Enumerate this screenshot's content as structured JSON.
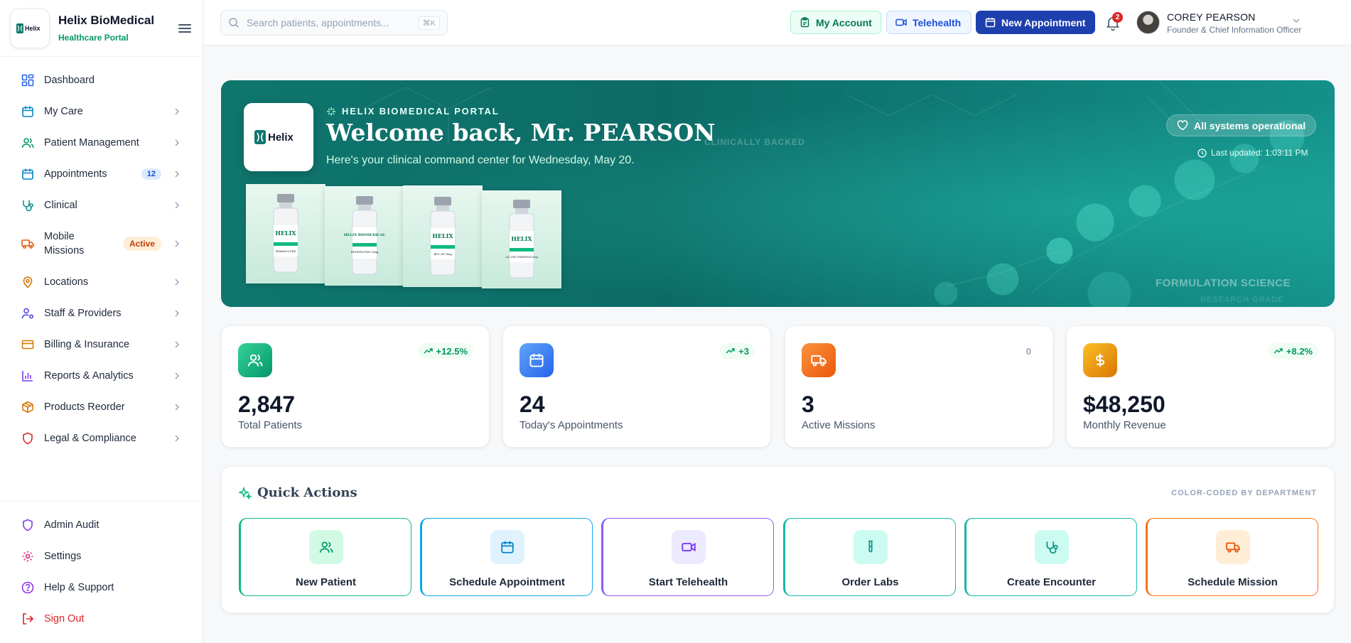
{
  "brand": {
    "name": "Helix BioMedical",
    "subtitle": "Healthcare Portal",
    "logo_text": "Helix"
  },
  "sidebar": {
    "items": [
      {
        "label": "Dashboard",
        "icon": "grid-icon",
        "color": "#2563eb"
      },
      {
        "label": "My Care",
        "icon": "calendar-icon",
        "color": "#0284c7"
      },
      {
        "label": "Patient Management",
        "icon": "users-icon",
        "color": "#059669"
      },
      {
        "label": "Appointments",
        "icon": "calendar-icon",
        "color": "#0284c7",
        "badge": "12"
      },
      {
        "label": "Clinical",
        "icon": "stethoscope-icon",
        "color": "#0d9488"
      },
      {
        "label": "Mobile Missions",
        "icon": "truck-icon",
        "color": "#ea580c",
        "badge": "Active"
      },
      {
        "label": "Locations",
        "icon": "map-pin-icon",
        "color": "#d97706"
      },
      {
        "label": "Staff & Providers",
        "icon": "user-cog-icon",
        "color": "#4f46e5"
      },
      {
        "label": "Billing & Insurance",
        "icon": "credit-card-icon",
        "color": "#d97706"
      },
      {
        "label": "Reports & Analytics",
        "icon": "bar-chart-icon",
        "color": "#7c3aed"
      },
      {
        "label": "Products Reorder",
        "icon": "package-icon",
        "color": "#d97706"
      },
      {
        "label": "Legal & Compliance",
        "icon": "shield-icon",
        "color": "#dc2626"
      }
    ],
    "bottom": [
      {
        "label": "Admin Audit",
        "icon": "shield-icon",
        "color": "#7c3aed"
      },
      {
        "label": "Settings",
        "icon": "gear-icon",
        "color": "#db2777"
      },
      {
        "label": "Help & Support",
        "icon": "help-circle-icon",
        "color": "#9333ea"
      },
      {
        "label": "Sign Out",
        "icon": "logout-icon",
        "color": "#dc2626"
      }
    ]
  },
  "topbar": {
    "search_placeholder": "Search patients, appointments...",
    "search_shortcut": "⌘K",
    "my_account": "My Account",
    "telehealth": "Telehealth",
    "new_appointment": "New Appointment",
    "notification_count": "2",
    "user_name": "COREY PEARSON",
    "user_role": "Founder & Chief Information Officer"
  },
  "hero": {
    "eyebrow": "HELIX BIOMEDICAL PORTAL",
    "title": "Welcome back, Mr. PEARSON",
    "subtitle": "Here's your clinical command center for Wednesday, May 20.",
    "status": "All systems operational",
    "last_updated": "Last updated: 1:03:11 PM",
    "ghost_text": "CLINICALLY BACKED",
    "ghost_bottom": "FORMULATION SCIENCE",
    "ghost_bottom2": "RESEARCH GRADE",
    "vials": [
      {
        "brand": "HELIX",
        "product": "SEMAGLUTIDE"
      },
      {
        "brand": "HELIX BIOMEDICAL",
        "product": "RETATRUTIDE 10mg"
      },
      {
        "brand": "HELIX",
        "product": "BPC-157 5mg"
      },
      {
        "brand": "HELIX",
        "product": "CJC-1295 / IPAMORELIN 10mg"
      }
    ]
  },
  "stats": [
    {
      "value": "2,847",
      "label": "Total Patients",
      "trend": "+12.5%",
      "icon": "users-icon",
      "color": "#10b981"
    },
    {
      "value": "24",
      "label": "Today's Appointments",
      "trend": "+3",
      "icon": "calendar-icon",
      "color": "#3b82f6"
    },
    {
      "value": "3",
      "label": "Active Missions",
      "trend": "0",
      "icon": "truck-icon",
      "color": "#f97316"
    },
    {
      "value": "$48,250",
      "label": "Monthly Revenue",
      "trend": "+8.2%",
      "icon": "dollar-icon",
      "color": "#f59e0b"
    }
  ],
  "quick_actions": {
    "title": "Quick Actions",
    "hint": "COLOR-CODED BY DEPARTMENT",
    "items": [
      {
        "label": "New Patient",
        "icon": "users-icon",
        "color": "#10b981"
      },
      {
        "label": "Schedule Appointment",
        "icon": "calendar-icon",
        "color": "#0ea5e9"
      },
      {
        "label": "Start Telehealth",
        "icon": "video-icon",
        "color": "#8b5cf6"
      },
      {
        "label": "Order Labs",
        "icon": "test-tube-icon",
        "color": "#14b8a6"
      },
      {
        "label": "Create Encounter",
        "icon": "stethoscope-icon",
        "color": "#14b8a6"
      },
      {
        "label": "Schedule Mission",
        "icon": "truck-icon",
        "color": "#f97316"
      }
    ]
  }
}
